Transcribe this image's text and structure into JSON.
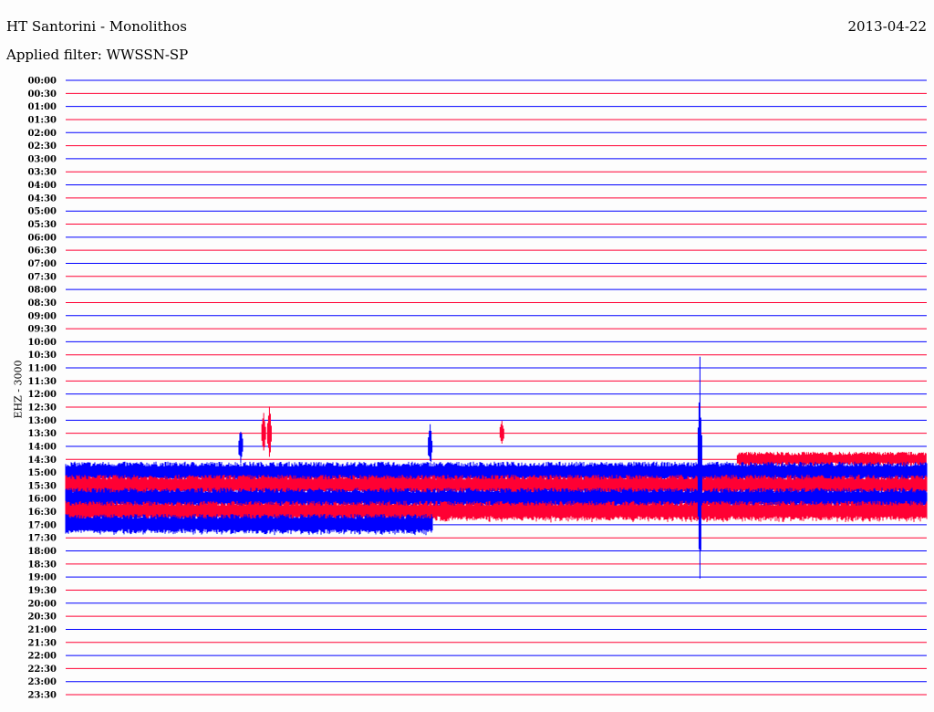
{
  "header": {
    "title": "HT Santorini - Monolithos",
    "date": "2013-04-22",
    "filter": "Applied filter: WWSSN-SP"
  },
  "chart_data": {
    "type": "line",
    "title": "HT Santorini - Monolithos",
    "ylabel": "EHZ - 3000",
    "trace_colors": [
      "#0000ff",
      "#ff0033"
    ],
    "time_labels": [
      "00:00",
      "00:30",
      "01:00",
      "01:30",
      "02:00",
      "02:30",
      "03:00",
      "03:30",
      "04:00",
      "04:30",
      "05:00",
      "05:30",
      "06:00",
      "06:30",
      "07:00",
      "07:30",
      "08:00",
      "08:30",
      "09:00",
      "09:30",
      "10:00",
      "10:30",
      "11:00",
      "11:30",
      "12:00",
      "12:30",
      "13:00",
      "13:30",
      "14:00",
      "14:30",
      "15:00",
      "15:30",
      "16:00",
      "16:30",
      "17:00",
      "17:30",
      "18:00",
      "18:30",
      "19:00",
      "19:30",
      "20:00",
      "20:30",
      "21:00",
      "21:30",
      "22:00",
      "22:30",
      "23:00",
      "23:30"
    ],
    "x_range_minutes": [
      0,
      30
    ],
    "noise_segments": [
      {
        "trace": "14:30",
        "start_min": 23.4,
        "end_min": 30,
        "amplitude": 0.6
      },
      {
        "trace": "15:00",
        "start_min": 0,
        "end_min": 30,
        "amplitude": 0.85
      },
      {
        "trace": "15:30",
        "start_min": 0,
        "end_min": 30,
        "amplitude": 0.85
      },
      {
        "trace": "16:00",
        "start_min": 0,
        "end_min": 30,
        "amplitude": 0.85
      },
      {
        "trace": "16:30",
        "start_min": 0,
        "end_min": 30,
        "amplitude": 0.85
      },
      {
        "trace": "17:00",
        "start_min": 0,
        "end_min": 12.8,
        "amplitude": 0.85
      }
    ],
    "events": [
      {
        "trace": "14:00",
        "minute": 6.1,
        "amplitude": 1.7
      },
      {
        "trace": "13:30",
        "minute": 6.9,
        "amplitude": 1.8
      },
      {
        "trace": "13:30",
        "minute": 7.1,
        "amplitude": 2.2
      },
      {
        "trace": "14:00",
        "minute": 12.7,
        "amplitude": 1.8
      },
      {
        "trace": "13:30",
        "minute": 15.2,
        "amplitude": 1.2
      },
      {
        "trace": "15:00",
        "minute": 22.1,
        "amplitude": 9.5
      }
    ]
  }
}
